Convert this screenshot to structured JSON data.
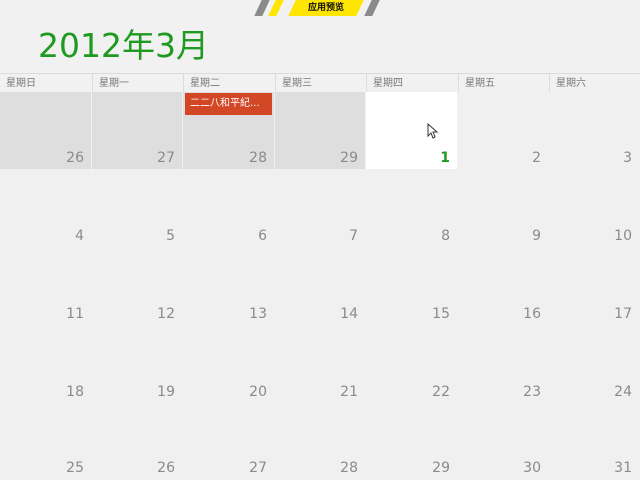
{
  "banner": {
    "label": "应用预览"
  },
  "title": "2012年3月",
  "weekdays": [
    "星期日",
    "星期一",
    "星期二",
    "星期三",
    "星期四",
    "星期五",
    "星期六"
  ],
  "weeks": [
    [
      "26",
      "27",
      "28",
      "29",
      "1",
      "2",
      "3"
    ],
    [
      "4",
      "5",
      "6",
      "7",
      "8",
      "9",
      "10"
    ],
    [
      "11",
      "12",
      "13",
      "14",
      "15",
      "16",
      "17"
    ],
    [
      "18",
      "19",
      "20",
      "21",
      "22",
      "23",
      "24"
    ],
    [
      "25",
      "26",
      "27",
      "28",
      "29",
      "30",
      "31"
    ]
  ],
  "event": {
    "label": "二二八和平紀..."
  },
  "colors": {
    "title": "#1f9a20",
    "event": "#d24726",
    "banner_yellow": "#ffe600",
    "banner_gray": "#8a8a8a"
  }
}
